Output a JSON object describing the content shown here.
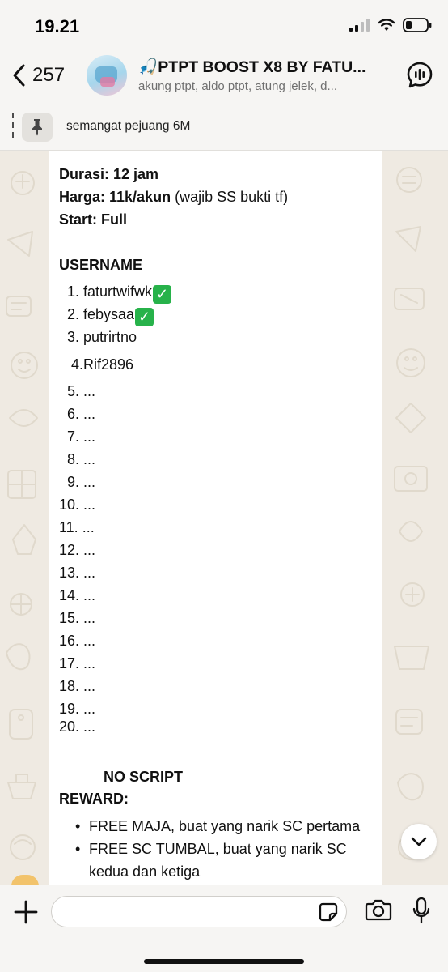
{
  "status_bar": {
    "time": "19.21"
  },
  "header": {
    "back_count": "257",
    "title": "🎣PTPT BOOST X8 BY FATU...",
    "subtitle": "akung ptpt, aldo ptpt, atung jelek, d..."
  },
  "pinned": {
    "text": "semangat pejuang 6M"
  },
  "message": {
    "durasi_label": "Durasi: 12 jam",
    "harga_label": "Harga: 11k/akun",
    "harga_note": " (wajib SS bukti tf)",
    "start_label": "Start: Full",
    "username_header": "USERNAME",
    "usernames": [
      "1. faturtwifwk",
      "2. febysaa",
      "3. putrirtno",
      "4.Rif2896",
      "5. ...",
      "6. ...",
      "7. ...",
      "8. ...",
      "9. ...",
      "10. ...",
      "11. ...",
      "12. ...",
      "13. ...",
      "14. ...",
      "15. ...",
      "16. ...",
      "17. ...",
      "18. ...",
      "19. ...",
      "20. ..."
    ],
    "check_mark": "✓",
    "no_script": "NO SCRIPT",
    "reward_label": "REWARD:",
    "rewards": [
      "FREE MAJA, buat yang narik SC pertama",
      "FREE SC TUMBAL, buat yang narik SC",
      "kedua dan ketiga"
    ],
    "bullet": "•"
  },
  "colors": {
    "chat_background": "#efeae2",
    "bubble": "#ffffff",
    "check_green": "#27b24a",
    "bar_background": "#f6f5f3"
  },
  "icons": [
    "signal-icon",
    "wifi-icon",
    "battery-icon",
    "back-chevron-icon",
    "voice-chat-icon",
    "pin-icon",
    "chevron-down-icon",
    "plus-icon",
    "sticker-icon",
    "camera-icon",
    "microphone-icon"
  ]
}
